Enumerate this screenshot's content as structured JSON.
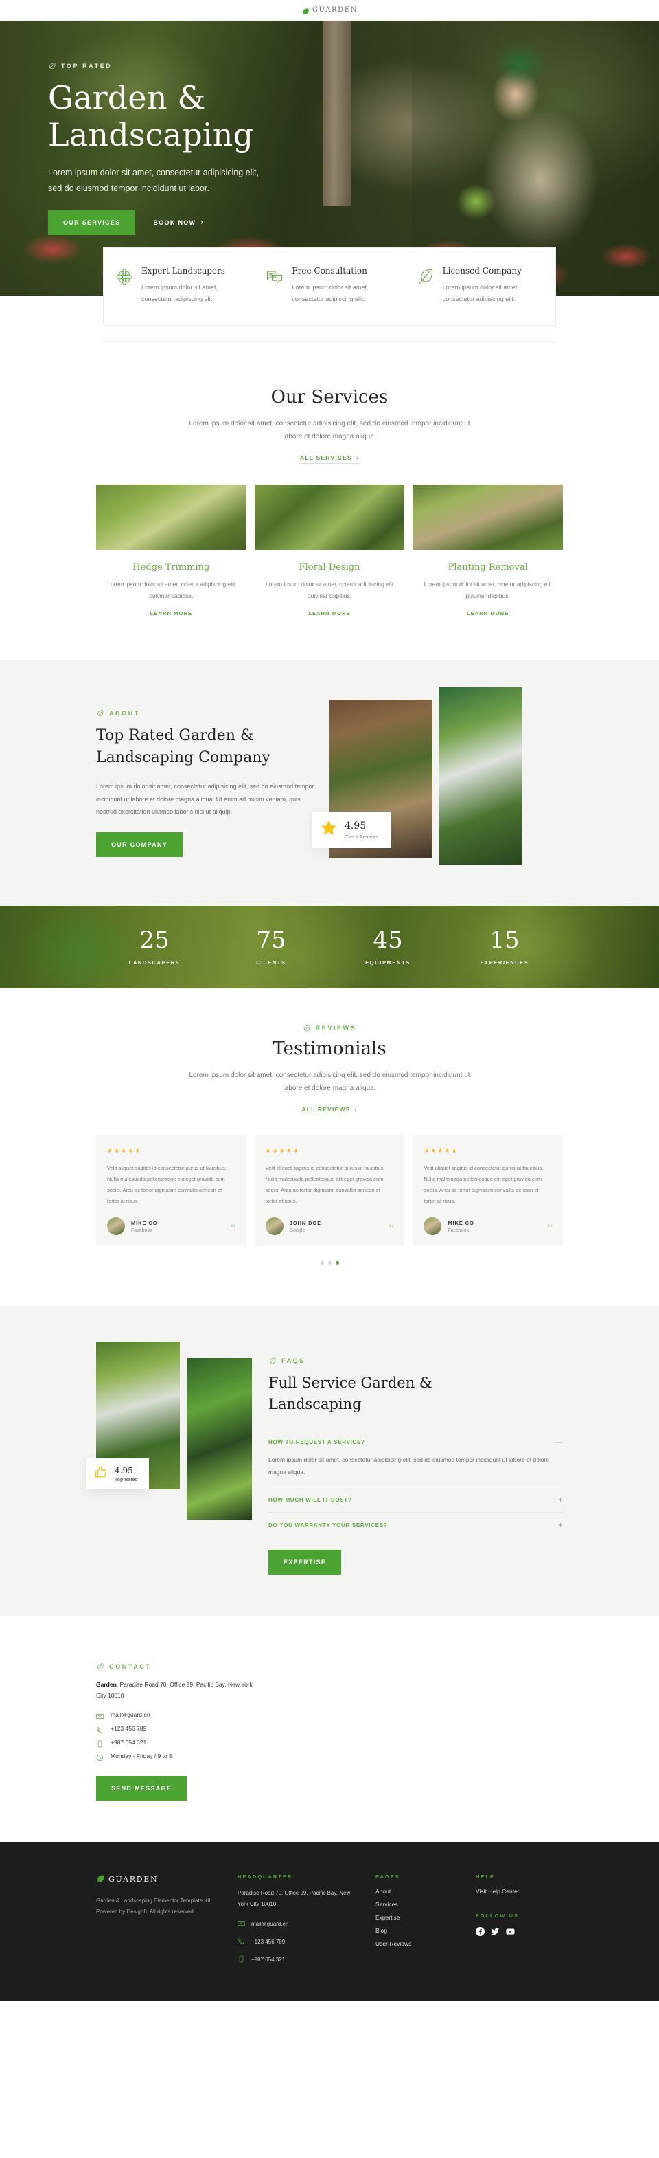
{
  "topbar": {
    "brand": "GUARDEN",
    "logo_icon": "leaf-icon"
  },
  "hero": {
    "eyebrow": "TOP RATED",
    "eyebrow_icon": "leaf-icon",
    "title_line1": "Garden &",
    "title_line2": "Landscaping",
    "lead": "Lorem ipsum dolor sit amet, consectetur adipisicing elit, sed do eiusmod tempor incididunt ut labor.",
    "primary_cta": "OUR SERVICES",
    "secondary_cta": "BOOK NOW",
    "secondary_cta_icon": "chevron-right-icon"
  },
  "features": [
    {
      "icon": "flower-icon",
      "title": "Expert Landscapers",
      "text": "Lorem ipsum dolor sit amet, consectetur adipiscing elit."
    },
    {
      "icon": "chat-icon",
      "title": "Free Consultation",
      "text": "Lorem ipsum dolor sit amet, consectetur adipiscing elit."
    },
    {
      "icon": "leaf-icon",
      "title": "Licensed Company",
      "text": "Lorem ipsum dolor sit amet, consectetur adipiscing elit."
    }
  ],
  "services": {
    "title": "Our Services",
    "desc": "Lorem ipsum dolor sit amet, consectetur adipisicing elit, sed do eiusmod tempor incididunt ut labore et dolore magna aliqua.",
    "all_link": "ALL SERVICES",
    "all_link_icon": "chevron-right-icon",
    "learn_more": "LEARN MORE",
    "items": [
      {
        "title": "Hedge Trimming",
        "text": "Lorem ipsum dolor sit amet, cctetur adipiscing elit pulvinar dapibus."
      },
      {
        "title": "Floral Design",
        "text": "Lorem ipsum dolor sit amet, cctetur adipiscing elit pulvinar dapibus."
      },
      {
        "title": "Planting Removal",
        "text": "Lorem ipsum dolor sit amet, cctetur adipiscing elit pulvinar dapibus."
      }
    ]
  },
  "about": {
    "eyebrow": "ABOUT",
    "eyebrow_icon": "leaf-icon",
    "title_line1": "Top Rated Garden &",
    "title_line2": "Landscaping Company",
    "body": "Lorem ipsum dolor sit amet, consectetur adipisicing elit, sed do eiusmod tempor incididunt ut labore et dolore magna aliqua. Ut enim ad minim veniam, quis nostrud exercitation ullamco laboris nisi ut aliquip.",
    "cta": "OUR COMPANY",
    "badge": {
      "icon": "star-icon",
      "value": "4.95",
      "label": "Client Reviews",
      "color": "#f5c518"
    }
  },
  "counters": [
    {
      "num": "25",
      "label": "LANDSCAPERS"
    },
    {
      "num": "75",
      "label": "CLIENTS"
    },
    {
      "num": "45",
      "label": "EQUIPMENTS"
    },
    {
      "num": "15",
      "label": "EXPERIENCES"
    }
  ],
  "testimonials": {
    "eyebrow": "REVIEWS",
    "eyebrow_icon": "leaf-icon",
    "title": "Testimonials",
    "desc": "Lorem ipsum dolor sit amet, consectetur adipisicing elit, sed do eiusmod tempor incididunt ut labore et dolore magna aliqua.",
    "all_link": "ALL REVIEWS",
    "all_link_icon": "chevron-right-icon",
    "stars": "★★★★★",
    "items": [
      {
        "quote": "Velit aliquet sagittis id consectetur purus ut faucibus. Nulla malesuada pellentesque elit eget gravida cum sociis. Arcu ac tortor dignissim convallis aenean et tortor at risus.",
        "name": "MIKE CO",
        "source": "Facebook"
      },
      {
        "quote": "Velit aliquet sagittis id consectetur purus ut faucibus. Nulla malesuada pellentesque elit eget gravida cum sociis. Arcu ac tortor dignissim convallis aenean et tortor at risus.",
        "name": "JOHN DOE",
        "source": "Google"
      },
      {
        "quote": "Velit aliquet sagittis id consectetur purus ut faucibus. Nulla malesuada pellentesque elit eget gravida cum sociis. Arcu ac tortor dignissim convallis aenean et tortor at risus.",
        "name": "MIKE CO",
        "source": "Facebook"
      }
    ]
  },
  "faq": {
    "eyebrow": "FAQS",
    "eyebrow_icon": "leaf-icon",
    "title_line1": "Full Service Garden &",
    "title_line2": "Landscaping",
    "badge": {
      "icon": "thumbs-up-icon",
      "value": "4.95",
      "label": "Top Rated",
      "color": "#f5c518"
    },
    "items": [
      {
        "q": "HOW TO REQUEST A SERVICE?",
        "sign": "—",
        "open": true,
        "a": "Lorem ipsum dolor sit amet, consectetur adipisicing elit, sed do eiusmod tempor incididunt ut labore et dolore magna aliqua."
      },
      {
        "q": "HOW MUCH WILL IT COST?",
        "sign": "+",
        "open": false,
        "a": ""
      },
      {
        "q": "DO YOU WARRANTY YOUR SERVICES?",
        "sign": "+",
        "open": false,
        "a": ""
      }
    ],
    "cta": "EXPERTISE"
  },
  "contact": {
    "eyebrow": "CONTACT",
    "eyebrow_icon": "leaf-icon",
    "label": "Garden",
    "address": ": Paradise Road 70, Office 99, Pacific Bay, New York City 10010",
    "rows": [
      {
        "icon": "mail-icon",
        "text": "mail@guard.en"
      },
      {
        "icon": "phone-icon",
        "text": "+123 456 789"
      },
      {
        "icon": "mobile-icon",
        "text": "+987 654 321"
      },
      {
        "icon": "clock-icon",
        "text": "Monday - Friday / 9 to 5"
      }
    ],
    "cta": "SEND MESSAGE"
  },
  "footer": {
    "brand": "GUARDEN",
    "brand_icon": "leaf-icon",
    "copy": "Garden & Landscaping Elementor Template Kit. Powered by Design8. All rights reserved.",
    "hq_head": "HEADQUARTER",
    "hq_address": "Paradise Road 70, Office 99, Pacific Bay, New York City 10010",
    "hq_rows": [
      {
        "icon": "mail-icon",
        "text": "mail@guard.en"
      },
      {
        "icon": "phone-icon",
        "text": "+123 456 789"
      },
      {
        "icon": "mobile-icon",
        "text": "+987 654 321"
      }
    ],
    "pages_head": "PAGES",
    "pages": [
      "About",
      "Services",
      "Expertise",
      "Blog",
      "User Reviews"
    ],
    "help_head": "HELP",
    "help_link": "Visit Help Center",
    "follow_head": "FOLLOW US",
    "social": [
      "facebook-icon",
      "twitter-icon",
      "youtube-icon"
    ]
  },
  "colors": {
    "accent": "#4ba432",
    "accent_light": "#66b03f",
    "star": "#f0b429",
    "dark": "#1d1d1d"
  }
}
